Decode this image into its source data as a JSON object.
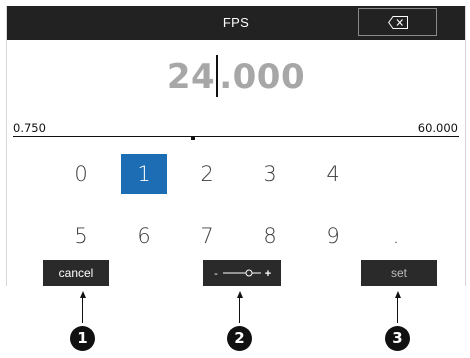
{
  "titlebar": {
    "title": "FPS"
  },
  "backspace": {
    "icon": "backspace-icon"
  },
  "value": {
    "before_cursor": "24",
    "after_cursor": ".000"
  },
  "range": {
    "min": "0.750",
    "max": "60.000"
  },
  "keypad": {
    "row1": [
      "0",
      "1",
      "2",
      "3",
      "4"
    ],
    "row2": [
      "5",
      "6",
      "7",
      "8",
      "9",
      "."
    ],
    "selected": "1",
    "selected_color": "#1d6db5"
  },
  "softkeys": {
    "cancel": "cancel",
    "slider_minus": "-",
    "slider_plus": "+",
    "set": "set"
  },
  "callouts": [
    "1",
    "2",
    "3"
  ]
}
